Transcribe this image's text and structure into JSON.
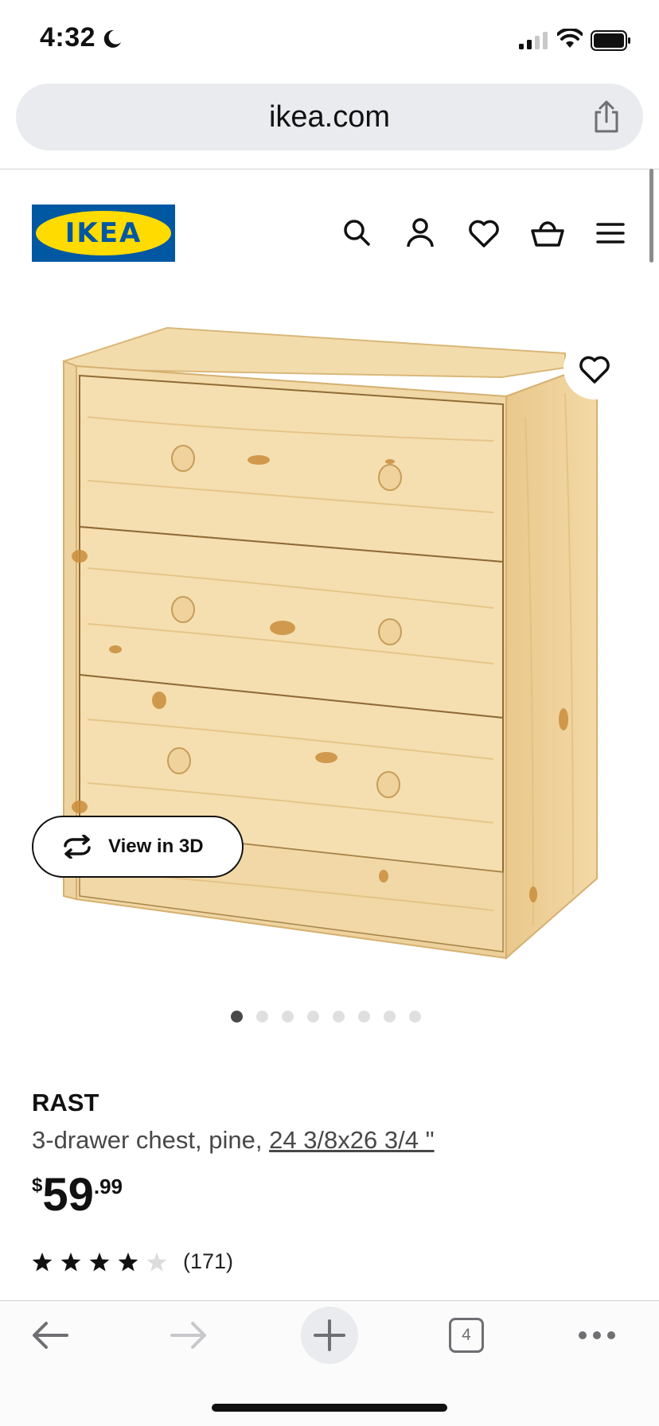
{
  "status_bar": {
    "time": "4:32",
    "icons": [
      "moon-icon",
      "cellular-signal-icon",
      "wifi-icon",
      "battery-icon"
    ]
  },
  "browser": {
    "url": "ikea.com",
    "share_icon": "share-icon"
  },
  "header": {
    "logo_text": "IKEA",
    "icons": [
      "search-icon",
      "account-icon",
      "heart-icon",
      "basket-icon",
      "menu-icon"
    ]
  },
  "product_gallery": {
    "view_in_3d_label": "View in 3D",
    "image_count": 8,
    "active_index": 0
  },
  "product": {
    "name": "RAST",
    "description": "3-drawer chest, pine, ",
    "dimensions": "24 3/8x26 3/4 \"",
    "price_currency": "$",
    "price_whole": "59",
    "price_cents": ".99",
    "rating": 4,
    "rating_max": 5,
    "review_count": "(171)"
  },
  "bottom_toolbar": {
    "tab_count": "4",
    "icons": [
      "back-icon",
      "forward-icon",
      "new-tab-icon",
      "tabs-icon",
      "more-icon"
    ]
  },
  "colors": {
    "ikea_blue": "#0058a3",
    "ikea_yellow": "#ffdb00",
    "pine": "#f1d7a3"
  }
}
